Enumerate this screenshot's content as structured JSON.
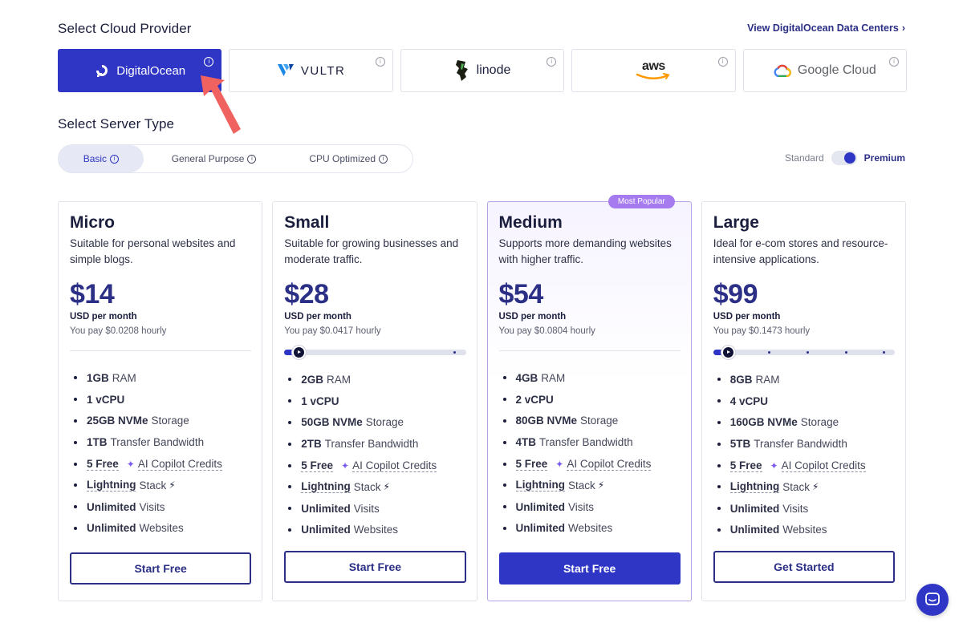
{
  "header": {
    "provider_title": "Select Cloud Provider",
    "datacenter_link": "View DigitalOcean Data Centers",
    "server_type_title": "Select Server Type"
  },
  "providers": [
    {
      "name": "DigitalOcean",
      "selected": true
    },
    {
      "name": "VULTR",
      "selected": false
    },
    {
      "name": "linode",
      "selected": false
    },
    {
      "name": "aws",
      "selected": false
    },
    {
      "name": "Google Cloud",
      "selected": false
    }
  ],
  "server_types": [
    {
      "label": "Basic",
      "selected": true
    },
    {
      "label": "General Purpose",
      "selected": false
    },
    {
      "label": "CPU Optimized",
      "selected": false
    }
  ],
  "tier": {
    "standard": "Standard",
    "premium": "Premium",
    "selected": "Premium"
  },
  "plans": [
    {
      "name": "Micro",
      "description": "Suitable for personal websites and simple blogs.",
      "price": "$14",
      "period": "USD per month",
      "hourly": "You pay $0.0208 hourly",
      "features": [
        {
          "bold": "1GB",
          "text": "RAM"
        },
        {
          "bold": "1 vCPU",
          "text": ""
        },
        {
          "bold": "25GB NVMe",
          "text": "Storage"
        },
        {
          "bold": "1TB",
          "text": "Transfer Bandwidth"
        },
        {
          "bold": "5 Free",
          "text": "AI Copilot Credits"
        },
        {
          "bold": "Lightning",
          "text": "Stack"
        },
        {
          "bold": "Unlimited",
          "text": "Visits"
        },
        {
          "bold": "Unlimited",
          "text": "Websites"
        }
      ],
      "cta": "Start Free"
    },
    {
      "name": "Small",
      "description": "Suitable for growing businesses and moderate traffic.",
      "price": "$28",
      "period": "USD per month",
      "hourly": "You pay $0.0417 hourly",
      "features": [
        {
          "bold": "2GB",
          "text": "RAM"
        },
        {
          "bold": "1 vCPU",
          "text": ""
        },
        {
          "bold": "50GB NVMe",
          "text": "Storage"
        },
        {
          "bold": "2TB",
          "text": "Transfer Bandwidth"
        },
        {
          "bold": "5 Free",
          "text": "AI Copilot Credits"
        },
        {
          "bold": "Lightning",
          "text": "Stack"
        },
        {
          "bold": "Unlimited",
          "text": "Visits"
        },
        {
          "bold": "Unlimited",
          "text": "Websites"
        }
      ],
      "cta": "Start Free"
    },
    {
      "name": "Medium",
      "badge": "Most Popular",
      "description": "Supports more demanding websites with higher traffic.",
      "price": "$54",
      "period": "USD per month",
      "hourly": "You pay $0.0804 hourly",
      "features": [
        {
          "bold": "4GB",
          "text": "RAM"
        },
        {
          "bold": "2 vCPU",
          "text": ""
        },
        {
          "bold": "80GB NVMe",
          "text": "Storage"
        },
        {
          "bold": "4TB",
          "text": "Transfer Bandwidth"
        },
        {
          "bold": "5 Free",
          "text": "AI Copilot Credits"
        },
        {
          "bold": "Lightning",
          "text": "Stack"
        },
        {
          "bold": "Unlimited",
          "text": "Visits"
        },
        {
          "bold": "Unlimited",
          "text": "Websites"
        }
      ],
      "cta": "Start Free"
    },
    {
      "name": "Large",
      "description": "Ideal for e-com stores and resource-intensive applications.",
      "price": "$99",
      "period": "USD per month",
      "hourly": "You pay $0.1473 hourly",
      "features": [
        {
          "bold": "8GB",
          "text": "RAM"
        },
        {
          "bold": "4 vCPU",
          "text": ""
        },
        {
          "bold": "160GB NVMe",
          "text": "Storage"
        },
        {
          "bold": "5TB",
          "text": "Transfer Bandwidth"
        },
        {
          "bold": "5 Free",
          "text": "AI Copilot Credits"
        },
        {
          "bold": "Lightning",
          "text": "Stack"
        },
        {
          "bold": "Unlimited",
          "text": "Visits"
        },
        {
          "bold": "Unlimited",
          "text": "Websites"
        }
      ],
      "cta": "Get Started"
    }
  ],
  "colors": {
    "accent": "#2f36c5",
    "brand_dark": "#2b2f86",
    "badge": "#a77bf0",
    "arrow": "#f0625f"
  }
}
